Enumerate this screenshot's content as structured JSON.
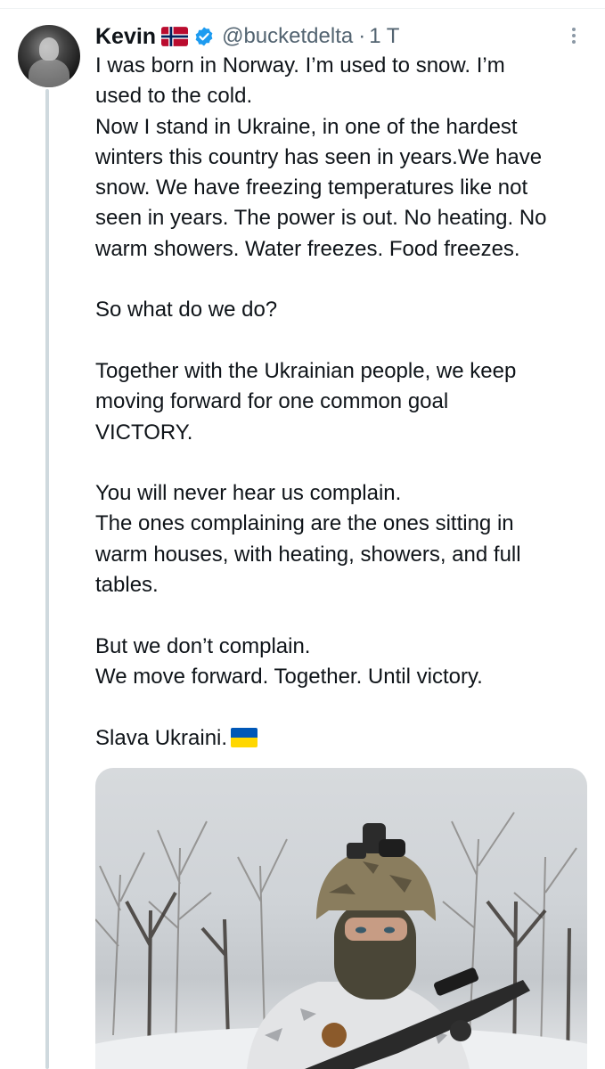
{
  "tweet": {
    "author_name": "Kevin",
    "author_flag_icon": "norway-flag-icon",
    "handle": "@bucketdelta",
    "separator": "·",
    "time": "1 T",
    "lines": [
      "I was born in Norway. I’m used to snow. I’m",
      "used to the cold.",
      "Now I stand in Ukraine, in one of the hardest",
      "winters this country has seen in years.We have",
      "snow. We have freezing temperatures like not",
      "seen in years. The power is out. No heating. No",
      "warm showers. Water freezes. Food freezes.",
      "",
      "So what do we do?",
      "",
      "Together with the Ukrainian people, we keep",
      "moving forward for one common goal",
      "VICTORY.",
      "",
      "You will never hear us complain.",
      "The ones complaining are the ones sitting in",
      "warm houses, with heating, showers, and full",
      "tables.",
      "",
      "But we don’t complain.",
      "We move forward. Together. Until victory.",
      "",
      "Slava Ukraini."
    ],
    "end_flag_icon": "ukraine-flag-icon",
    "media_icon": "photo-soldier-in-snowy-forest"
  },
  "colors": {
    "text": "#0f1419",
    "secondary": "#536471",
    "verified": "#1d9bf0",
    "thread_line": "#cfd9de"
  }
}
